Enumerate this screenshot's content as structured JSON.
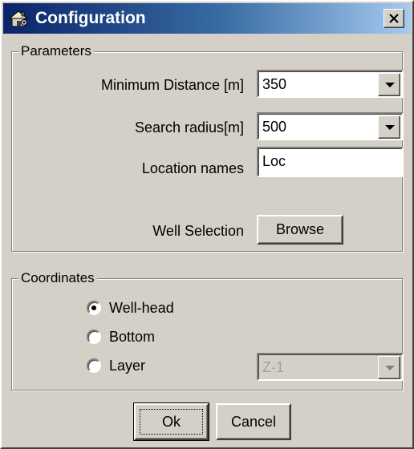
{
  "window": {
    "title": "Configuration",
    "icon": "settings-house-icon",
    "close_icon": "close-icon"
  },
  "parameters": {
    "legend": "Parameters",
    "min_distance_label": "Minimum Distance [m]",
    "min_distance_value": "350",
    "search_radius_label": "Search radius[m]",
    "search_radius_value": "500",
    "location_names_label": "Location names",
    "location_names_value": "Loc",
    "well_selection_label": "Well Selection",
    "browse_label": "Browse"
  },
  "coordinates": {
    "legend": "Coordinates",
    "options": [
      {
        "label": "Well-head",
        "selected": true
      },
      {
        "label": "Bottom",
        "selected": false
      },
      {
        "label": "Layer",
        "selected": false
      }
    ],
    "layer_value": "Z-1"
  },
  "buttons": {
    "ok_label": "Ok",
    "cancel_label": "Cancel"
  },
  "colors": {
    "face": "#d4d0c8",
    "title_start": "#0a246a",
    "title_end": "#a6caf0"
  }
}
